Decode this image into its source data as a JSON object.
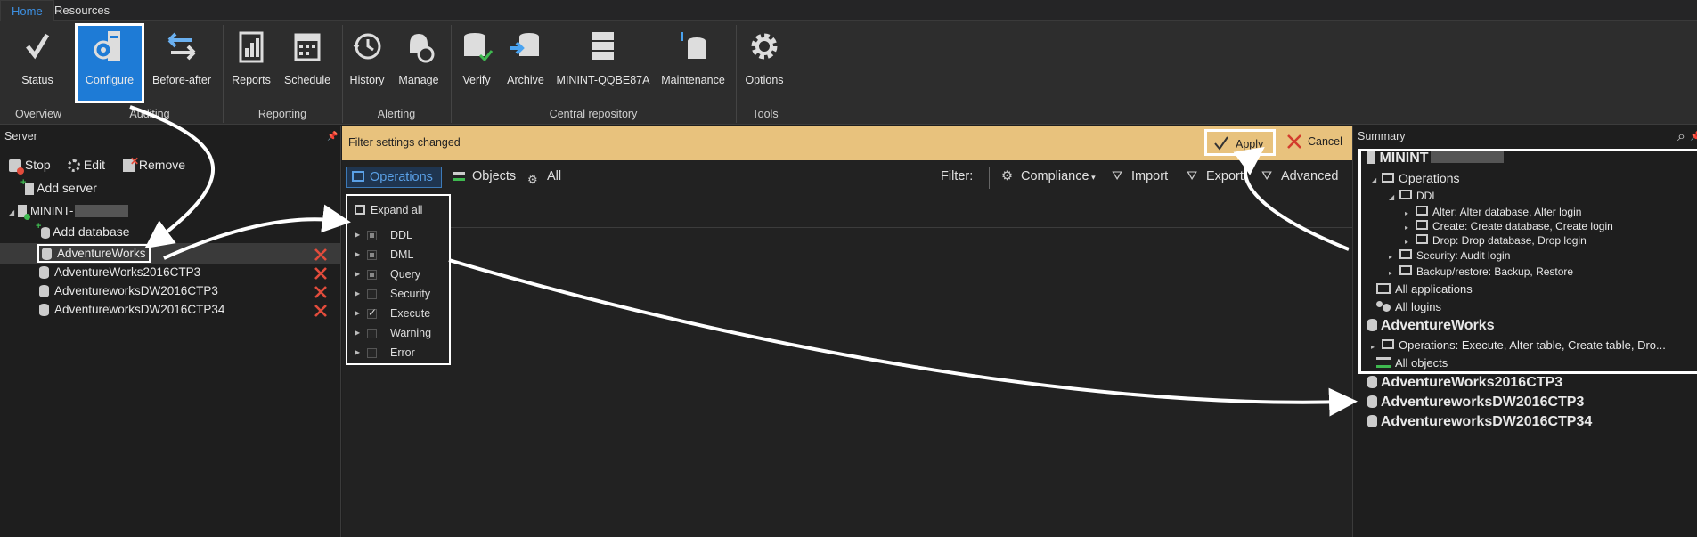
{
  "tabs": [
    "Home",
    "Resources"
  ],
  "ribbon": {
    "buttons": {
      "status": "Status",
      "configure": "Configure",
      "before_after": "Before-after",
      "reports": "Reports",
      "schedule": "Schedule",
      "history": "History",
      "manage": "Manage",
      "verify": "Verify",
      "archive": "Archive",
      "server": "MININT-QQBE87A",
      "maintenance": "Maintenance",
      "options": "Options"
    },
    "groups": {
      "overview": "Overview",
      "auditing": "Auditing",
      "reporting": "Reporting",
      "alerting": "Alerting",
      "central": "Central repository",
      "tools": "Tools"
    }
  },
  "server_panel": {
    "title": "Server",
    "toolbar": {
      "stop": "Stop",
      "edit": "Edit",
      "remove": "Remove"
    },
    "add_server": "Add server",
    "server_name": "MININT-",
    "add_database": "Add database",
    "databases": [
      "AdventureWorks",
      "AdventureWorks2016CTP3",
      "AdventureworksDW2016CTP3",
      "AdventureworksDW2016CTP34"
    ]
  },
  "center": {
    "banner": "Filter settings changed",
    "apply": "Apply",
    "cancel": "Cancel",
    "view_tabs": {
      "operations": "Operations",
      "objects": "Objects",
      "all": "All"
    },
    "filter_label": "Filter:",
    "filters": {
      "compliance": "Compliance",
      "import": "Import",
      "export": "Export",
      "advanced": "Advanced"
    },
    "expand_all": "Expand all",
    "filter_items": [
      {
        "label": "DDL",
        "state": "partial"
      },
      {
        "label": "DML",
        "state": "partial"
      },
      {
        "label": "Query",
        "state": "partial"
      },
      {
        "label": "Security",
        "state": "none"
      },
      {
        "label": "Execute",
        "state": "checked"
      },
      {
        "label": "Warning",
        "state": "none"
      },
      {
        "label": "Error",
        "state": "none"
      }
    ]
  },
  "summary": {
    "title": "Summary",
    "server": "MININT",
    "operations": "Operations",
    "ddl": "DDL",
    "alter": "Alter: Alter database, Alter login",
    "create": "Create: Create database, Create login",
    "drop": "Drop: Drop database, Drop login",
    "security": "Security: Audit login",
    "backup": "Backup/restore: Backup, Restore",
    "all_applications": "All applications",
    "all_logins": "All logins",
    "db1": "AdventureWorks",
    "db1_ops": "Operations: Execute, Alter table, Create table, Dro...",
    "all_objects": "All objects",
    "db2": "AdventureWorks2016CTP3",
    "db3": "AdventureworksDW2016CTP3",
    "db4": "AdventureworksDW2016CTP34"
  },
  "colors": {
    "accent": "#1e7bd6",
    "banner": "#e8c27d",
    "danger": "#e24c3c"
  }
}
